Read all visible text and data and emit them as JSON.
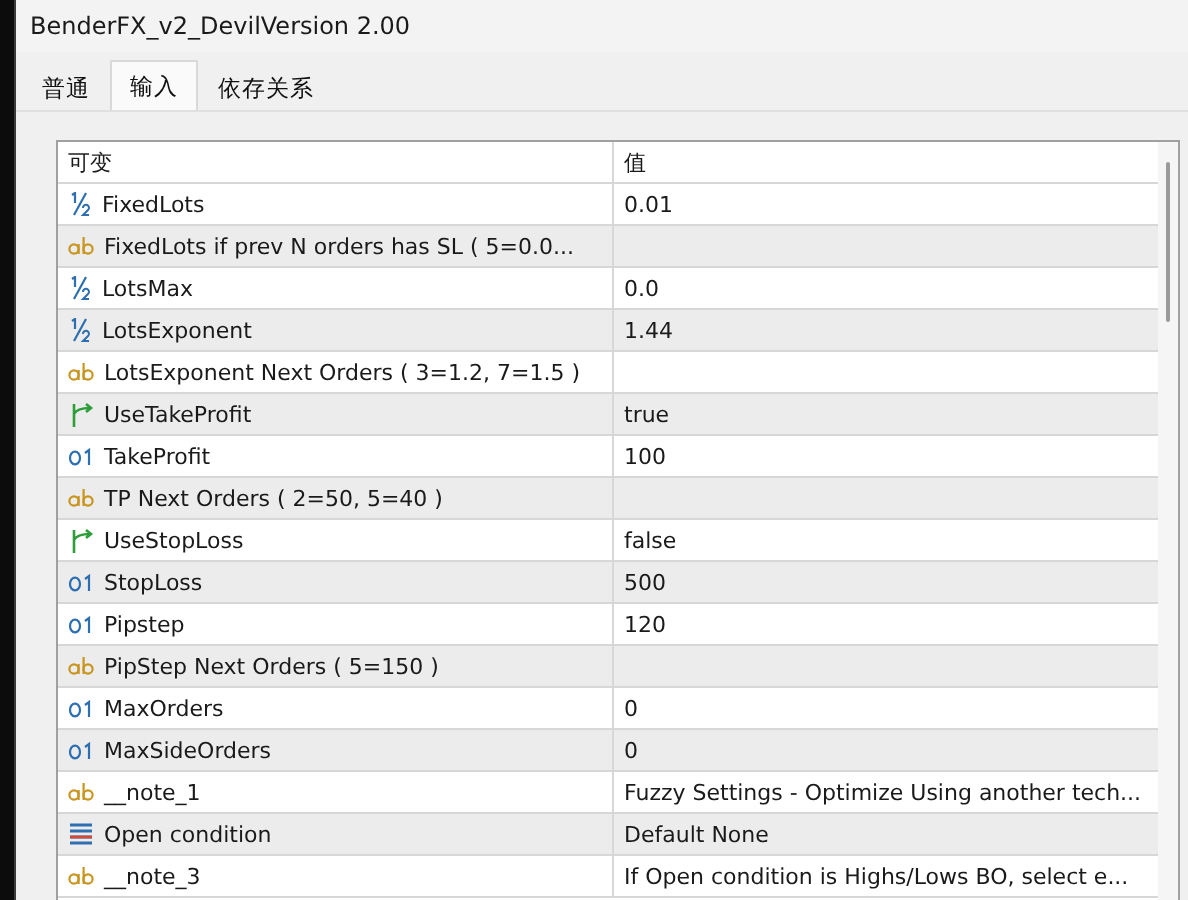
{
  "window": {
    "title": "BenderFX_v2_DevilVersion 2.00"
  },
  "tabs": [
    {
      "label": "普通",
      "selected": false
    },
    {
      "label": "输入",
      "selected": true
    },
    {
      "label": "依存关系",
      "selected": false
    }
  ],
  "table": {
    "columns": [
      "可变",
      "值"
    ],
    "rows": [
      {
        "kind": "double",
        "name": "FixedLots",
        "value": "0.01"
      },
      {
        "kind": "string",
        "name": "FixedLots if prev N orders has SL ( 5=0.0...",
        "value": ""
      },
      {
        "kind": "double",
        "name": "LotsMax",
        "value": "0.0"
      },
      {
        "kind": "double",
        "name": "LotsExponent",
        "value": "1.44"
      },
      {
        "kind": "string",
        "name": "LotsExponent Next Orders ( 3=1.2, 7=1.5 )",
        "value": ""
      },
      {
        "kind": "bool",
        "name": "UseTakeProfit",
        "value": "true"
      },
      {
        "kind": "int",
        "name": "TakeProfit",
        "value": "100"
      },
      {
        "kind": "string",
        "name": "TP Next Orders ( 2=50, 5=40 )",
        "value": ""
      },
      {
        "kind": "bool",
        "name": "UseStopLoss",
        "value": "false"
      },
      {
        "kind": "int",
        "name": "StopLoss",
        "value": "500"
      },
      {
        "kind": "int",
        "name": "Pipstep",
        "value": "120"
      },
      {
        "kind": "string",
        "name": "PipStep Next Orders ( 5=150 )",
        "value": ""
      },
      {
        "kind": "int",
        "name": "MaxOrders",
        "value": "0"
      },
      {
        "kind": "int",
        "name": "MaxSideOrders",
        "value": "0"
      },
      {
        "kind": "string",
        "name": "__note_1",
        "value": "Fuzzy Settings - Optimize Using another tech..."
      },
      {
        "kind": "enum",
        "name": "Open condition",
        "value": "Default None"
      },
      {
        "kind": "string",
        "name": "__note_3",
        "value": "If Open condition is Highs/Lows BO, select e..."
      }
    ]
  }
}
